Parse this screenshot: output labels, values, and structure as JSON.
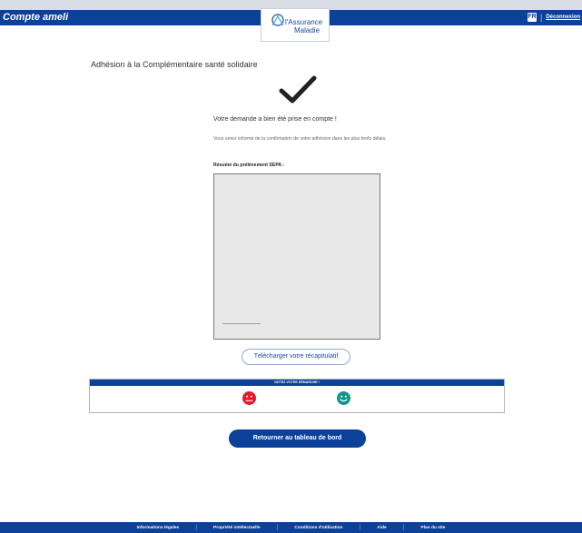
{
  "header": {
    "brand": "Compte ameli",
    "logo_line1": "l'Assurance",
    "logo_line2": "Maladie",
    "logout_label": "Déconnexion",
    "icon_label": "FR"
  },
  "main": {
    "title": "Adhésion à la Complémentaire santé solidaire",
    "confirm_text": "Votre demande a bien été prise en compte !",
    "info_text": "Vous serez informé de la confirmation de votre adhésion dans les plus brefs délais.",
    "sepa_title": "Résumé du prélèvement SEPA :",
    "download_button": "Télécharger votre récapitulatif",
    "rating_title": "NOTEZ VOTRE DÉMARCHE !",
    "primary_button": "Retourner au tableau de bord"
  },
  "footer": {
    "links": [
      "Informations légales",
      "Propriété intellectuelle",
      "Conditions d'utilisation",
      "Aide",
      "Plan du site"
    ]
  },
  "colors": {
    "brand_blue": "#0c419a",
    "sad_red": "#e8192c",
    "happy_teal": "#11968a"
  }
}
